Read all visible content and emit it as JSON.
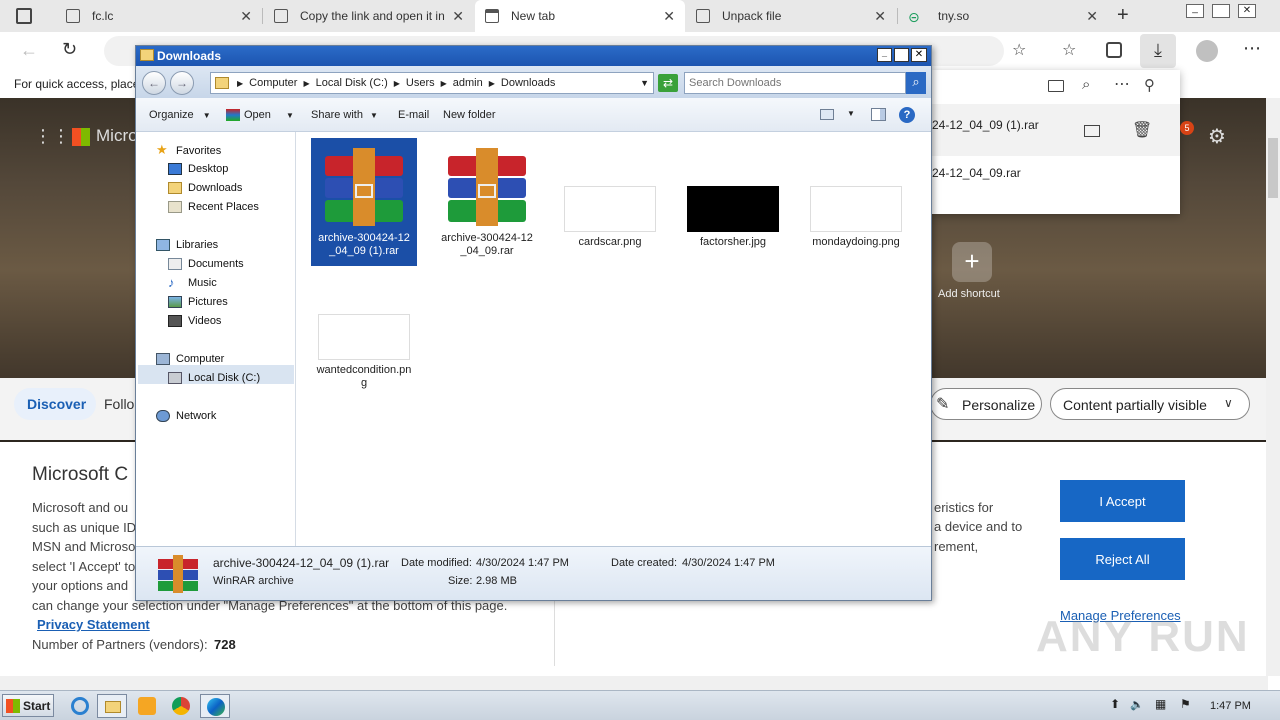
{
  "browser": {
    "tabs": [
      {
        "label": "fc.lc"
      },
      {
        "label": "Copy the link and open it in"
      },
      {
        "label": "New tab"
      },
      {
        "label": "Unpack file"
      },
      {
        "label": "tny.so"
      }
    ],
    "favbar_text": "For quick access, place",
    "newtab": {
      "apps_brand": "Micro",
      "add_shortcut": "Add shortcut",
      "discover": "Discover",
      "following": "Follo",
      "personalize": "Personalize",
      "content_visibility": "Content partially visible"
    },
    "downloads_panel": {
      "file1": "24-12_04_09 (1).rar",
      "file2": "24-12_04_09.rar",
      "badge": "5"
    },
    "consent": {
      "title": "Microsoft C",
      "lines": [
        "Microsoft and ou",
        "such as unique ID",
        "MSN and Microso",
        "select 'I Accept' to",
        "your options and",
        "can change your selection under \"Manage Preferences\" at the bottom of this page."
      ],
      "right_lines": [
        "eristics for",
        "a device and to",
        "rement,"
      ],
      "privacy": "Privacy Statement",
      "partners_label": "Number of Partners (vendors):",
      "partners_count": "728",
      "accept": "I Accept",
      "reject": "Reject All",
      "manage": "Manage Preferences"
    }
  },
  "explorer": {
    "title": "Downloads",
    "breadcrumb": [
      "Computer",
      "Local Disk (C:)",
      "Users",
      "admin",
      "Downloads"
    ],
    "search_placeholder": "Search Downloads",
    "toolbar": {
      "organize": "Organize",
      "open": "Open",
      "share": "Share with",
      "email": "E-mail",
      "new_folder": "New folder"
    },
    "nav": {
      "favorites": "Favorites",
      "desktop": "Desktop",
      "downloads": "Downloads",
      "recent": "Recent Places",
      "libraries": "Libraries",
      "documents": "Documents",
      "music": "Music",
      "pictures": "Pictures",
      "videos": "Videos",
      "computer": "Computer",
      "local_disk": "Local Disk (C:)",
      "network": "Network"
    },
    "files": [
      {
        "name": "archive-300424-12_04_09 (1).rar",
        "line1": "archive-300424-12",
        "line2": "_04_09 (1).rar"
      },
      {
        "name": "archive-300424-12_04_09.rar",
        "line1": "archive-300424-12",
        "line2": "_04_09.rar"
      },
      {
        "name": "cardscar.png",
        "line1": "cardscar.png",
        "line2": ""
      },
      {
        "name": "factorsher.jpg",
        "line1": "factorsher.jpg",
        "line2": ""
      },
      {
        "name": "mondaydoing.png",
        "line1": "mondaydoing.png",
        "line2": ""
      },
      {
        "name": "wantedcondition.png",
        "line1": "wantedcondition.pn",
        "line2": "g"
      }
    ],
    "details": {
      "filename": "archive-300424-12_04_09 (1).rar",
      "type": "WinRAR archive",
      "date_modified_label": "Date modified:",
      "date_modified": "4/30/2024 1:47 PM",
      "date_created_label": "Date created:",
      "date_created": "4/30/2024 1:47 PM",
      "size_label": "Size:",
      "size": "2.98 MB"
    }
  },
  "taskbar": {
    "start": "Start",
    "clock": "1:47 PM"
  },
  "watermark": "ANY RUN"
}
